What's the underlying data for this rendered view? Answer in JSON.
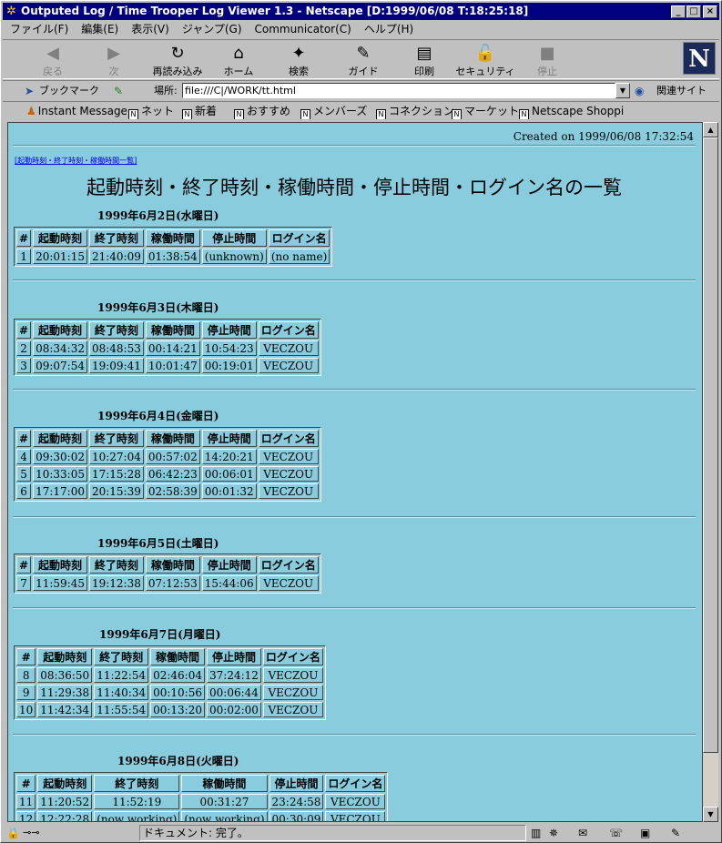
{
  "window": {
    "title": "Outputed Log / Time Trooper Log Viewer 1.3 - Netscape [D:1999/06/08 T:18:25:18]",
    "controls": [
      "_",
      "□",
      "×"
    ]
  },
  "menu": [
    "ファイル(F)",
    "編集(E)",
    "表示(V)",
    "ジャンプ(G)",
    "Communicator(C)",
    "ヘルプ(H)"
  ],
  "toolbar": [
    {
      "label": "戻る",
      "icon": "back-icon",
      "glyph": "◀",
      "enabled": false
    },
    {
      "label": "次",
      "icon": "forward-icon",
      "glyph": "▶",
      "enabled": false
    },
    {
      "label": "再読み込み",
      "icon": "reload-icon",
      "glyph": "↻",
      "enabled": true
    },
    {
      "label": "ホーム",
      "icon": "home-icon",
      "glyph": "⌂",
      "enabled": true
    },
    {
      "label": "検索",
      "icon": "search-icon",
      "glyph": "✦",
      "enabled": true
    },
    {
      "label": "ガイド",
      "icon": "guide-icon",
      "glyph": "✎",
      "enabled": true
    },
    {
      "label": "印刷",
      "icon": "print-icon",
      "glyph": "▤",
      "enabled": true
    },
    {
      "label": "セキュリティ",
      "icon": "lock-icon",
      "glyph": "🔓",
      "enabled": true
    },
    {
      "label": "停止",
      "icon": "stop-icon",
      "glyph": "■",
      "enabled": false
    }
  ],
  "logo": "N",
  "location": {
    "bookmark_label": "ブックマーク",
    "field_label": "場所:",
    "url": "file:///C|/WORK/tt.html",
    "related_label": "関連サイト"
  },
  "personal_bar": [
    "Instant Message",
    "ネット",
    "新着",
    "おすすめ",
    "メンバーズ",
    "コネクション",
    "マーケット",
    "Netscape Shoppi"
  ],
  "page": {
    "created": "Created on 1999/06/08 17:32:54",
    "top_link": "[起動時刻・終了時刻・稼働時間一覧]",
    "title": "起動時刻・終了時刻・稼働時間・停止時間・ログイン名の一覧",
    "headers": [
      "#",
      "起動時刻",
      "終了時刻",
      "稼働時間",
      "停止時間",
      "ログイン名"
    ],
    "days": [
      {
        "date": "1999年6月2日(水曜日)",
        "rows": [
          [
            "1",
            "20:01:15",
            "21:40:09",
            "01:38:54",
            "(unknown)",
            "(no name)"
          ]
        ]
      },
      {
        "date": "1999年6月3日(木曜日)",
        "rows": [
          [
            "2",
            "08:34:32",
            "08:48:53",
            "00:14:21",
            "10:54:23",
            "VECZOU"
          ],
          [
            "3",
            "09:07:54",
            "19:09:41",
            "10:01:47",
            "00:19:01",
            "VECZOU"
          ]
        ]
      },
      {
        "date": "1999年6月4日(金曜日)",
        "rows": [
          [
            "4",
            "09:30:02",
            "10:27:04",
            "00:57:02",
            "14:20:21",
            "VECZOU"
          ],
          [
            "5",
            "10:33:05",
            "17:15:28",
            "06:42:23",
            "00:06:01",
            "VECZOU"
          ],
          [
            "6",
            "17:17:00",
            "20:15:39",
            "02:58:39",
            "00:01:32",
            "VECZOU"
          ]
        ]
      },
      {
        "date": "1999年6月5日(土曜日)",
        "rows": [
          [
            "7",
            "11:59:45",
            "19:12:38",
            "07:12:53",
            "15:44:06",
            "VECZOU"
          ]
        ]
      },
      {
        "date": "1999年6月7日(月曜日)",
        "rows": [
          [
            "8",
            "08:36:50",
            "11:22:54",
            "02:46:04",
            "37:24:12",
            "VECZOU"
          ],
          [
            "9",
            "11:29:38",
            "11:40:34",
            "00:10:56",
            "00:06:44",
            "VECZOU"
          ],
          [
            "10",
            "11:42:34",
            "11:55:54",
            "00:13:20",
            "00:02:00",
            "VECZOU"
          ]
        ]
      },
      {
        "date": "1999年6月8日(火曜日)",
        "rows": [
          [
            "11",
            "11:20:52",
            "11:52:19",
            "00:31:27",
            "23:24:58",
            "VECZOU"
          ],
          [
            "12",
            "12:22:28",
            "(now working)",
            "(now working)",
            "00:30:09",
            "VECZOU"
          ]
        ]
      }
    ]
  },
  "status": {
    "text": "ドキュメント: 完了。"
  }
}
